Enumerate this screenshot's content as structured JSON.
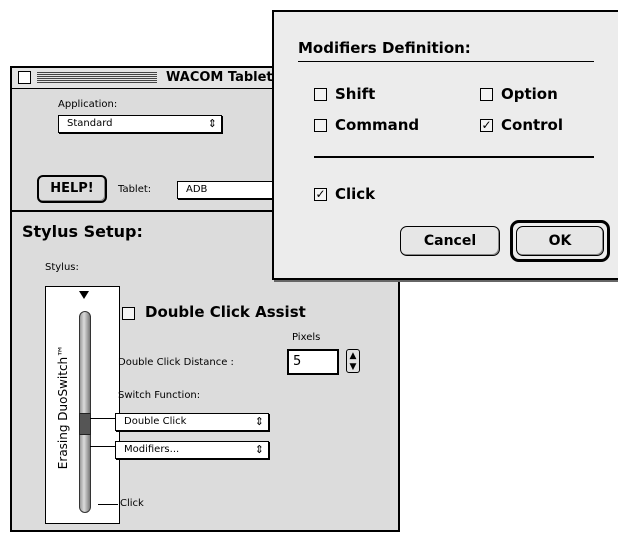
{
  "tablet_window": {
    "title": "WACOM Tablet",
    "application_label": "Application:",
    "application_value": "Standard",
    "help_label": "HELP!",
    "tablet_label": "Tablet:",
    "tablet_value": "ADB",
    "stylus_setup_title": "Stylus Setup:",
    "stylus_label": "Stylus:",
    "stylus_name": "Erasing DuoSwitch™",
    "double_click_assist_label": "Double Click Assist",
    "pixels_label": "Pixels",
    "double_click_distance_label": "Double Click Distance :",
    "double_click_distance_value": "5",
    "switch_function_label": "Switch Function:",
    "switch_function_value": "Double Click",
    "modifiers_value": "Modifiers...",
    "tip_label": "Click"
  },
  "modifiers_dialog": {
    "title": "Modifiers Definition:",
    "options": [
      {
        "label": "Shift",
        "checked": false
      },
      {
        "label": "Option",
        "checked": false
      },
      {
        "label": "Command",
        "checked": false
      },
      {
        "label": "Control",
        "checked": true
      }
    ],
    "click_label": "Click",
    "click_checked": true,
    "cancel_label": "Cancel",
    "ok_label": "OK"
  }
}
